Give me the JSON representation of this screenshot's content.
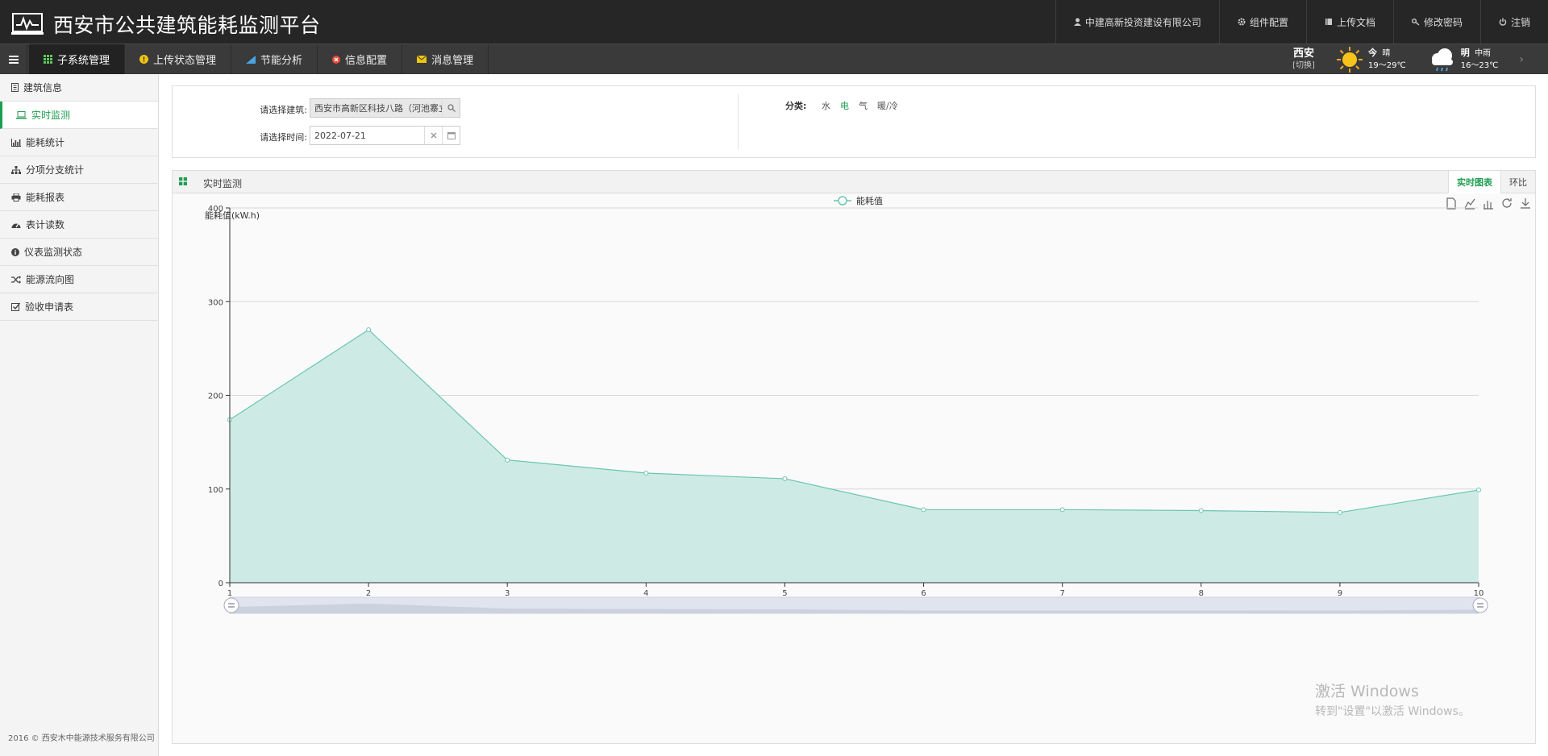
{
  "header": {
    "title": "西安市公共建筑能耗监测平台",
    "company": "中建高新投资建设有限公司",
    "links": [
      "组件配置",
      "上传文档",
      "修改密码",
      "注销"
    ]
  },
  "nav": {
    "tabs": [
      "子系统管理",
      "上传状态管理",
      "节能分析",
      "信息配置",
      "消息管理"
    ],
    "active_index": 0
  },
  "weather": {
    "city": "西安",
    "switch": "[切换]",
    "today_label": "今",
    "today_cond": "晴",
    "today_temp": "19～29℃",
    "tomorrow_label": "明",
    "tomorrow_cond": "中雨",
    "tomorrow_temp": "16～23℃"
  },
  "sidebar": {
    "items": [
      "建筑信息",
      "实时监测",
      "能耗统计",
      "分项分支统计",
      "能耗报表",
      "表计读数",
      "仪表监测状态",
      "能源流向图",
      "验收申请表"
    ],
    "active_index": 1,
    "copyright": "2016 © 西安木中能源技术服务有限公司"
  },
  "filter": {
    "building_label": "请选择建筑:",
    "building_value": "西安市高新区科技八路（河池寨立",
    "time_label": "请选择时间:",
    "time_value": "2022-07-21",
    "category_label": "分类:",
    "categories": [
      "水",
      "电",
      "气",
      "暖/冷"
    ],
    "category_active": 1
  },
  "panel": {
    "title": "实时监测",
    "tabs": [
      "实时图表",
      "环比"
    ],
    "active_tab": 0
  },
  "chart_data": {
    "type": "area",
    "x": [
      1,
      2,
      3,
      4,
      5,
      6,
      7,
      8,
      9,
      10
    ],
    "series": [
      {
        "name": "能耗值",
        "values": [
          174,
          270,
          131,
          117,
          111,
          78,
          78,
          77,
          75,
          99
        ]
      }
    ],
    "ylabel": "能耗值(kW.h)",
    "ylim": [
      0,
      400
    ],
    "yticks": [
      0,
      100,
      200,
      300,
      400
    ],
    "grid": true,
    "legend": "top-center",
    "colors": {
      "line": "#6cc5b0",
      "fill": "#cdebe4"
    }
  },
  "watermark": {
    "line1": "激活 Windows",
    "line2": "转到\"设置\"以激活 Windows。"
  }
}
